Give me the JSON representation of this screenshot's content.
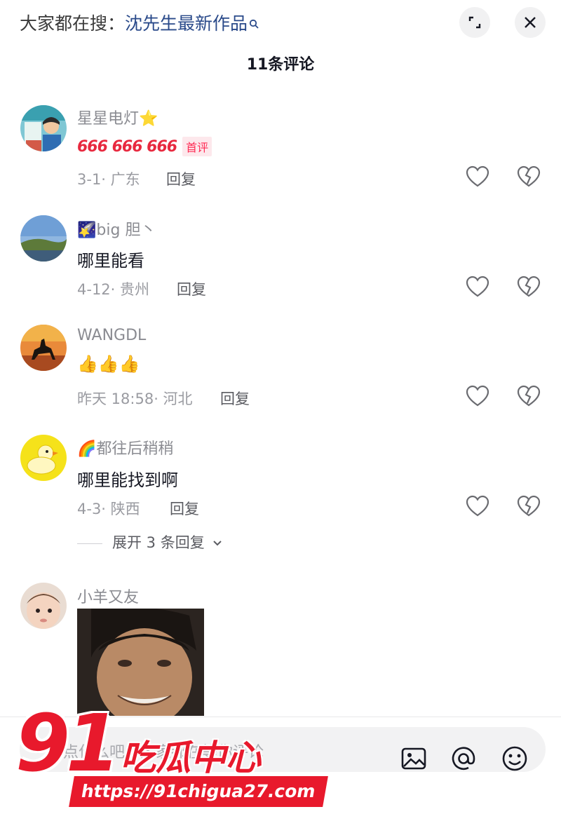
{
  "header": {
    "search_prefix": "大家都在搜：",
    "search_keyword": "沈先生最新作品",
    "comment_count_title": "11条评论"
  },
  "comments": [
    {
      "username": "星星电灯",
      "username_emoji": "⭐",
      "text_emoji": "666 666 666",
      "badge": "首评",
      "meta": "3-1· 广东",
      "reply_label": "回复"
    },
    {
      "username_emoji": "🌠",
      "username": "big 胆丶",
      "text": "哪里能看",
      "meta": "4-12· 贵州",
      "reply_label": "回复"
    },
    {
      "username": "WANGDL",
      "text": "👍👍👍",
      "meta": "昨天 18:58· 河北",
      "reply_label": "回复"
    },
    {
      "username_emoji": "🌈",
      "username": "都往后稍稍",
      "text": "哪里能找到啊",
      "meta": "4-3· 陕西",
      "reply_label": "回复",
      "expand_replies": "展开 3 条回复"
    },
    {
      "username": "小羊又友"
    }
  ],
  "bottom_bar": {
    "input_placeholder": "说点什么吧，大家都在等你评论"
  },
  "watermark": {
    "number": "91",
    "name": "吃瓜中心",
    "url": "https://91chigua27.com"
  },
  "colors": {
    "accent_red": "#fe2c55",
    "keyword_blue": "#2a4a8a",
    "watermark_red": "#e8192c"
  },
  "icons": [
    "search-icon",
    "expand-icon",
    "close-icon",
    "heart-icon",
    "broken-heart-icon",
    "image-icon",
    "at-icon",
    "emoji-icon",
    "chevron-down-icon"
  ]
}
